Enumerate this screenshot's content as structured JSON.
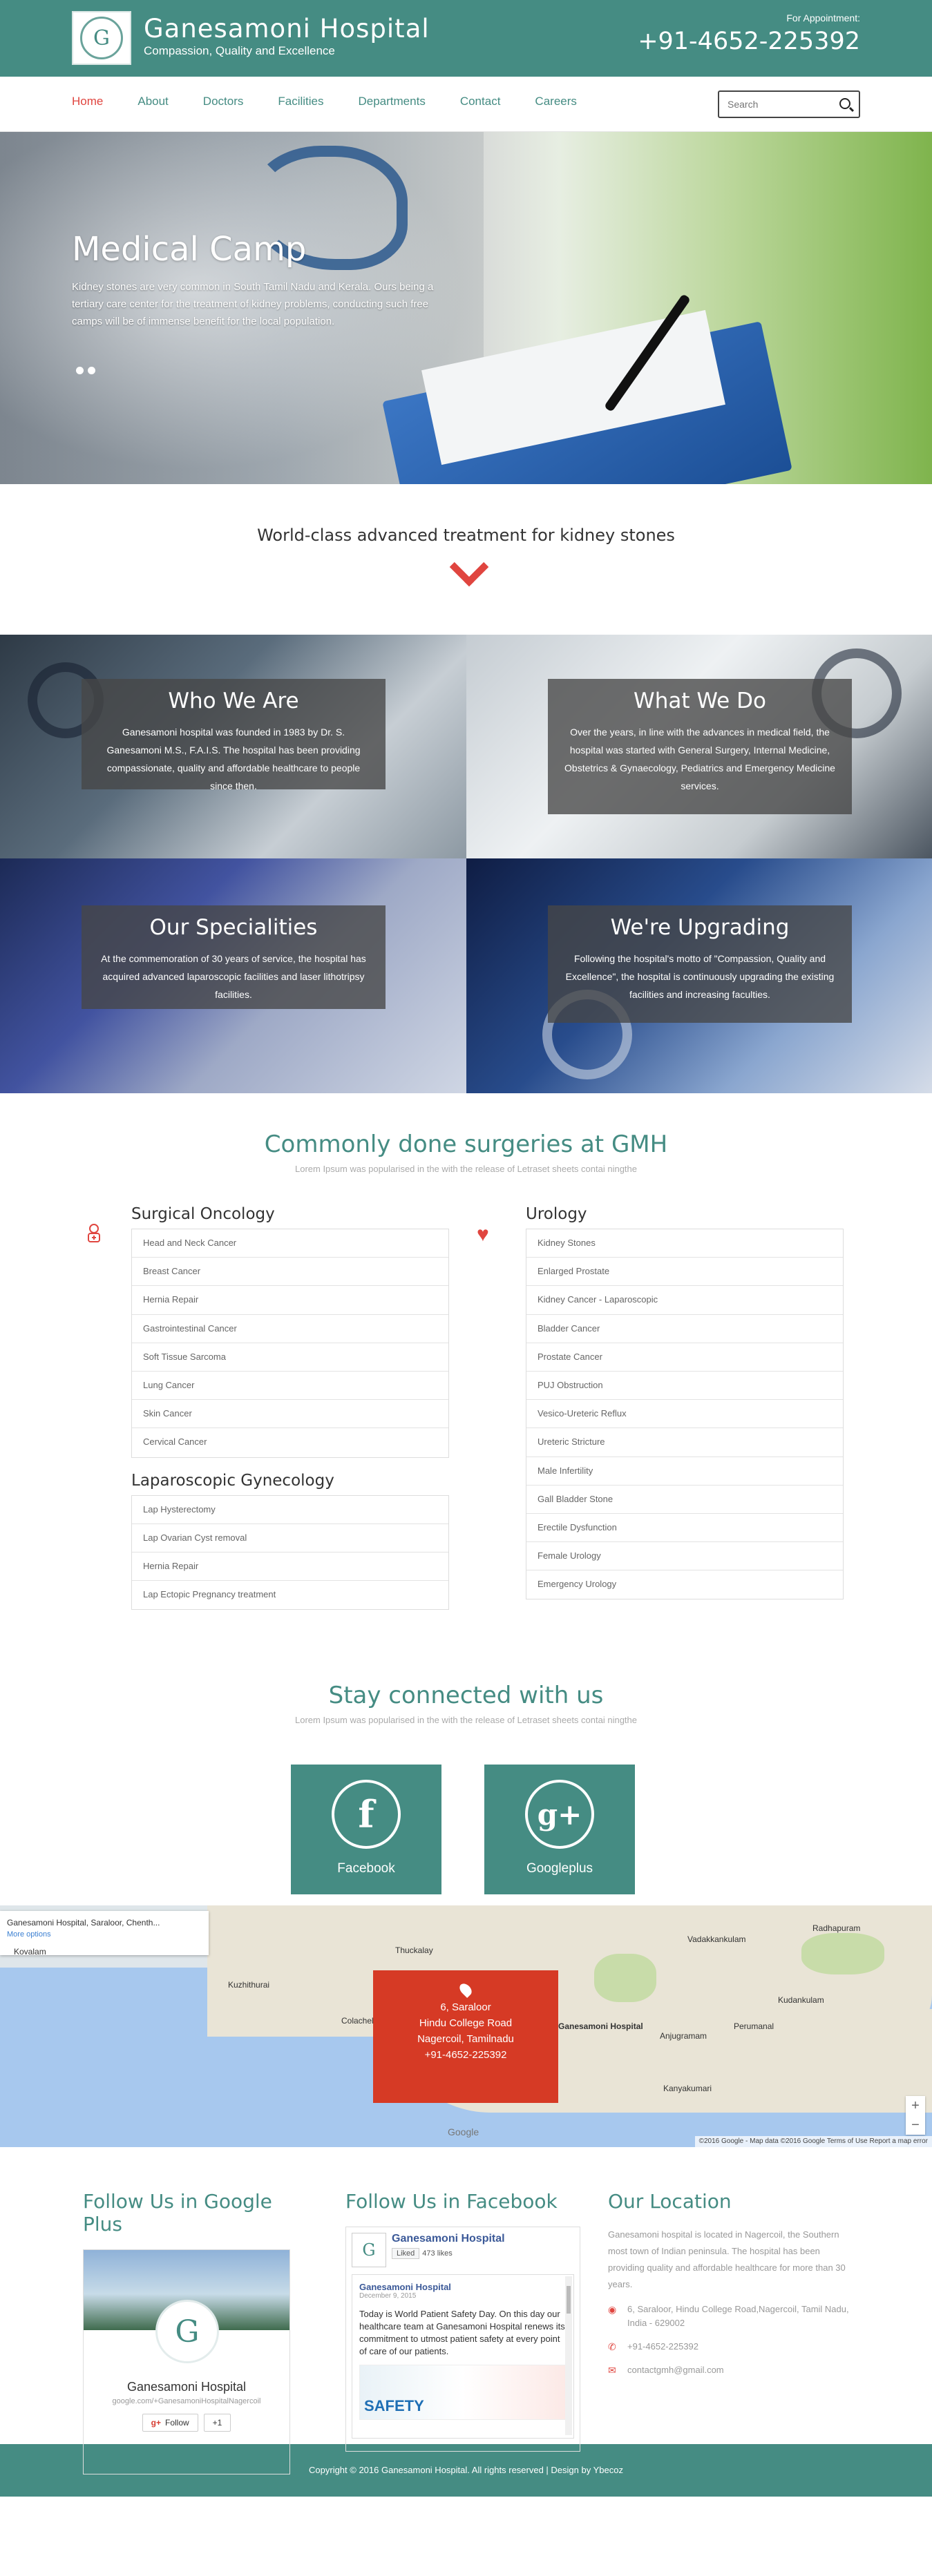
{
  "header": {
    "logo_letter": "G",
    "title": "Ganesamoni Hospital",
    "tagline": "Compassion, Quality and Excellence",
    "appointment_label": "For Appointment:",
    "phone": "+91-4652-225392"
  },
  "nav": {
    "items": [
      {
        "label": "Home",
        "active": true
      },
      {
        "label": "About"
      },
      {
        "label": "Doctors"
      },
      {
        "label": "Facilities"
      },
      {
        "label": "Departments"
      },
      {
        "label": "Contact"
      },
      {
        "label": "Careers"
      }
    ],
    "search_placeholder": "Search"
  },
  "hero": {
    "title": "Medical Camp",
    "text": "Kidney stones are very common in South Tamil Nadu and Kerala. Ours being a tertiary care center for the treatment of kidney problems, conducting such free camps will be of immense benefit for the local population.",
    "slides": 2
  },
  "tagline": "World-class advanced treatment for kidney stones",
  "features": [
    {
      "title": "Who We Are",
      "text": "Ganesamoni hospital was founded in 1983 by Dr. S. Ganesamoni M.S., F.A.I.S. The hospital has been providing compassionate, quality and affordable healthcare to people since then."
    },
    {
      "title": "What We Do",
      "text": "Over the years, in line with the advances in medical field, the hospital was started with General Surgery, Internal Medicine, Obstetrics & Gynaecology, Pediatrics and Emergency Medicine services."
    },
    {
      "title": "Our Specialities",
      "text": "At the commemoration of 30 years of service, the hospital has acquired advanced laparoscopic facilities and laser lithotripsy facilities."
    },
    {
      "title": "We're Upgrading",
      "text": "Following the hospital's motto of \"Compassion, Quality and Excellence\", the hospital is continuously upgrading the existing facilities and increasing faculties."
    }
  ],
  "surgeries": {
    "title": "Commonly done surgeries at GMH",
    "subtitle": "Lorem Ipsum was popularised in the with the release of Letraset sheets contai ningthe",
    "surgical_oncology": {
      "heading": "Surgical Oncology",
      "items": [
        "Head and Neck Cancer",
        "Breast Cancer",
        "Hernia Repair",
        "Gastrointestinal Cancer",
        "Soft Tissue Sarcoma",
        "Lung Cancer",
        "Skin Cancer",
        "Cervical Cancer"
      ]
    },
    "laparoscopic": {
      "heading": "Laparoscopic Gynecology",
      "items": [
        "Lap Hysterectomy",
        "Lap Ovarian Cyst removal",
        "Hernia Repair",
        "Lap Ectopic Pregnancy treatment"
      ]
    },
    "urology": {
      "heading": "Urology",
      "items": [
        "Kidney Stones",
        "Enlarged Prostate",
        "Kidney Cancer - Laparoscopic",
        "Bladder Cancer",
        "Prostate Cancer",
        "PUJ Obstruction",
        "Vesico-Ureteric Reflux",
        "Ureteric Stricture",
        "Male Infertility",
        "Gall Bladder Stone",
        "Erectile Dysfunction",
        "Female Urology",
        "Emergency Urology"
      ]
    }
  },
  "social": {
    "title": "Stay connected with us",
    "subtitle": "Lorem Ipsum was popularised in the with the release of Letraset sheets contai ningthe",
    "facebook_glyph": "f",
    "facebook_label": "Facebook",
    "gplus_glyph": "g+",
    "gplus_label": "Googleplus"
  },
  "map": {
    "place": "Ganesamoni Hospital, Saraloor, Chenth...",
    "more": "More options",
    "address_lines": [
      "6, Saraloor",
      "Hindu College Road",
      "Nagercoil, Tamilnadu",
      "+91-4652-225392"
    ],
    "town_labels": [
      "Thuckalay",
      "Colachel",
      "Vadakkankulam",
      "Radhapuram",
      "Kudankulam",
      "Anjugramam",
      "Perumanal",
      "Kanyakumari",
      "Kovalam",
      "Kuzhithurai"
    ],
    "marker_label": "Ganesamoni Hospital",
    "google": "Google",
    "attribution": "©2016 Google - Map data ©2016 Google   Terms of Use   Report a map error"
  },
  "follow": {
    "gplus_heading": "Follow Us in Google Plus",
    "gplus_name": "Ganesamoni Hospital",
    "gplus_url": "google.com/+GanesamoniHospitalNagercoil",
    "gplus_follow": "Follow",
    "gplus_plus1": "+1",
    "fb_heading": "Follow Us in Facebook",
    "fb_page": "Ganesamoni Hospital",
    "fb_liked": "Liked",
    "fb_likes": "473 likes",
    "fb_post_name": "Ganesamoni Hospital",
    "fb_post_date": "December 9, 2015",
    "fb_post_text": "Today is World Patient Safety Day. On this day our healthcare team at Ganesamoni Hospital renews its commitment to utmost patient safety at every point of care of our patients.",
    "fb_post_image_text": "SAFETY",
    "loc_heading": "Our Location",
    "loc_text": "Ganesamoni hospital is located in Nagercoil, the Southern most town of Indian peninsula. The hospital has been providing quality and affordable healthcare for more than 30 years.",
    "address": "6, Saraloor, Hindu College Road,Nagercoil, Tamil Nadu, India - 629002",
    "phone": "+91-4652-225392",
    "email": "contactgmh@gmail.com"
  },
  "footer": {
    "text": "Copyright © 2016 Ganesamoni Hospital. All rights reserved | Design by Ybecoz"
  }
}
